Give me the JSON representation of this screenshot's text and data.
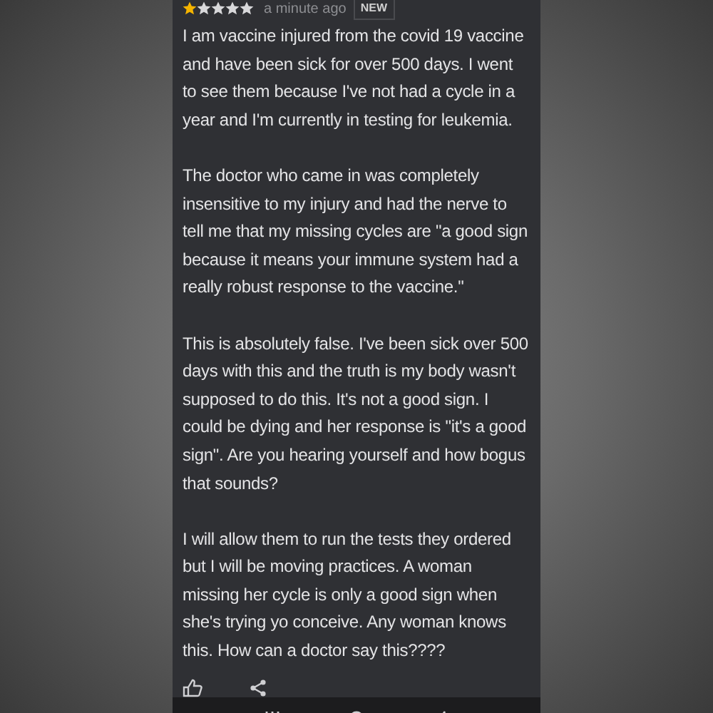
{
  "review": {
    "stars": 1,
    "time": "a minute ago",
    "badge": "NEW",
    "paragraphs": [
      "I am vaccine injured from the covid 19 vaccine and have been sick for over 500 days. I went to see them because I've not had a cycle in a year and I'm currently in testing for leukemia.",
      "The doctor who came in was completely insensitive to my injury and had the nerve to tell me that my missing cycles are \"a good sign because it means your immune system had a really robust response to the vaccine.\"",
      "This is absolutely false. I've been sick over 500 days with this and the truth is my body wasn't supposed to do this. It's not a good sign. I could be dying and her response is \"it's a good sign\". Are you hearing yourself and how bogus that sounds?",
      "I will allow them to run the tests they ordered but I will be moving practices. A woman missing her cycle is only a good sign when she's trying yo conceive. Any woman knows this. How can a doctor say this????"
    ]
  }
}
